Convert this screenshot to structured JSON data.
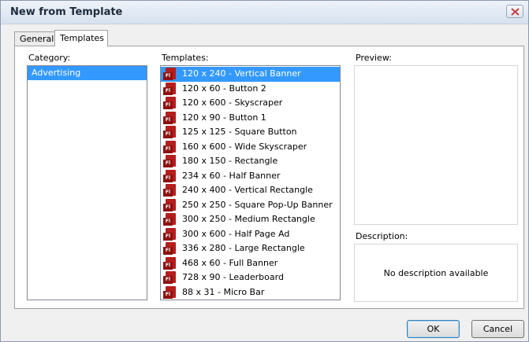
{
  "window": {
    "title": "New from Template"
  },
  "tabs": [
    {
      "label": "General",
      "active": false
    },
    {
      "label": "Templates",
      "active": true
    }
  ],
  "category": {
    "label": "Category:",
    "items": [
      {
        "label": "Advertising",
        "selected": true
      }
    ]
  },
  "templates": {
    "label": "Templates:",
    "icon": "flash-file-icon",
    "items": [
      {
        "label": "120 x 240 - Vertical Banner",
        "selected": true
      },
      {
        "label": "120 x 60 - Button 2"
      },
      {
        "label": "120 x 600 - Skyscraper"
      },
      {
        "label": "120 x 90 - Button 1"
      },
      {
        "label": "125 x 125 - Square Button"
      },
      {
        "label": "160 x 600 - Wide Skyscraper"
      },
      {
        "label": "180 x 150 - Rectangle"
      },
      {
        "label": "234 x 60 - Half Banner"
      },
      {
        "label": "240 x 400 - Vertical Rectangle"
      },
      {
        "label": "250 x 250 - Square Pop-Up Banner"
      },
      {
        "label": "300 x 250 - Medium Rectangle"
      },
      {
        "label": "300 x 600 - Half Page Ad"
      },
      {
        "label": "336 x 280 - Large Rectangle"
      },
      {
        "label": "468 x 60 - Full Banner"
      },
      {
        "label": "728 x 90 - Leaderboard"
      },
      {
        "label": "88 x 31 - Micro Bar"
      }
    ]
  },
  "preview": {
    "label": "Preview:"
  },
  "description": {
    "label": "Description:",
    "text": "No description available"
  },
  "buttons": {
    "ok": "OK",
    "cancel": "Cancel"
  },
  "colors": {
    "selection": "#3399ff",
    "flash_icon": "#b51e1e"
  }
}
